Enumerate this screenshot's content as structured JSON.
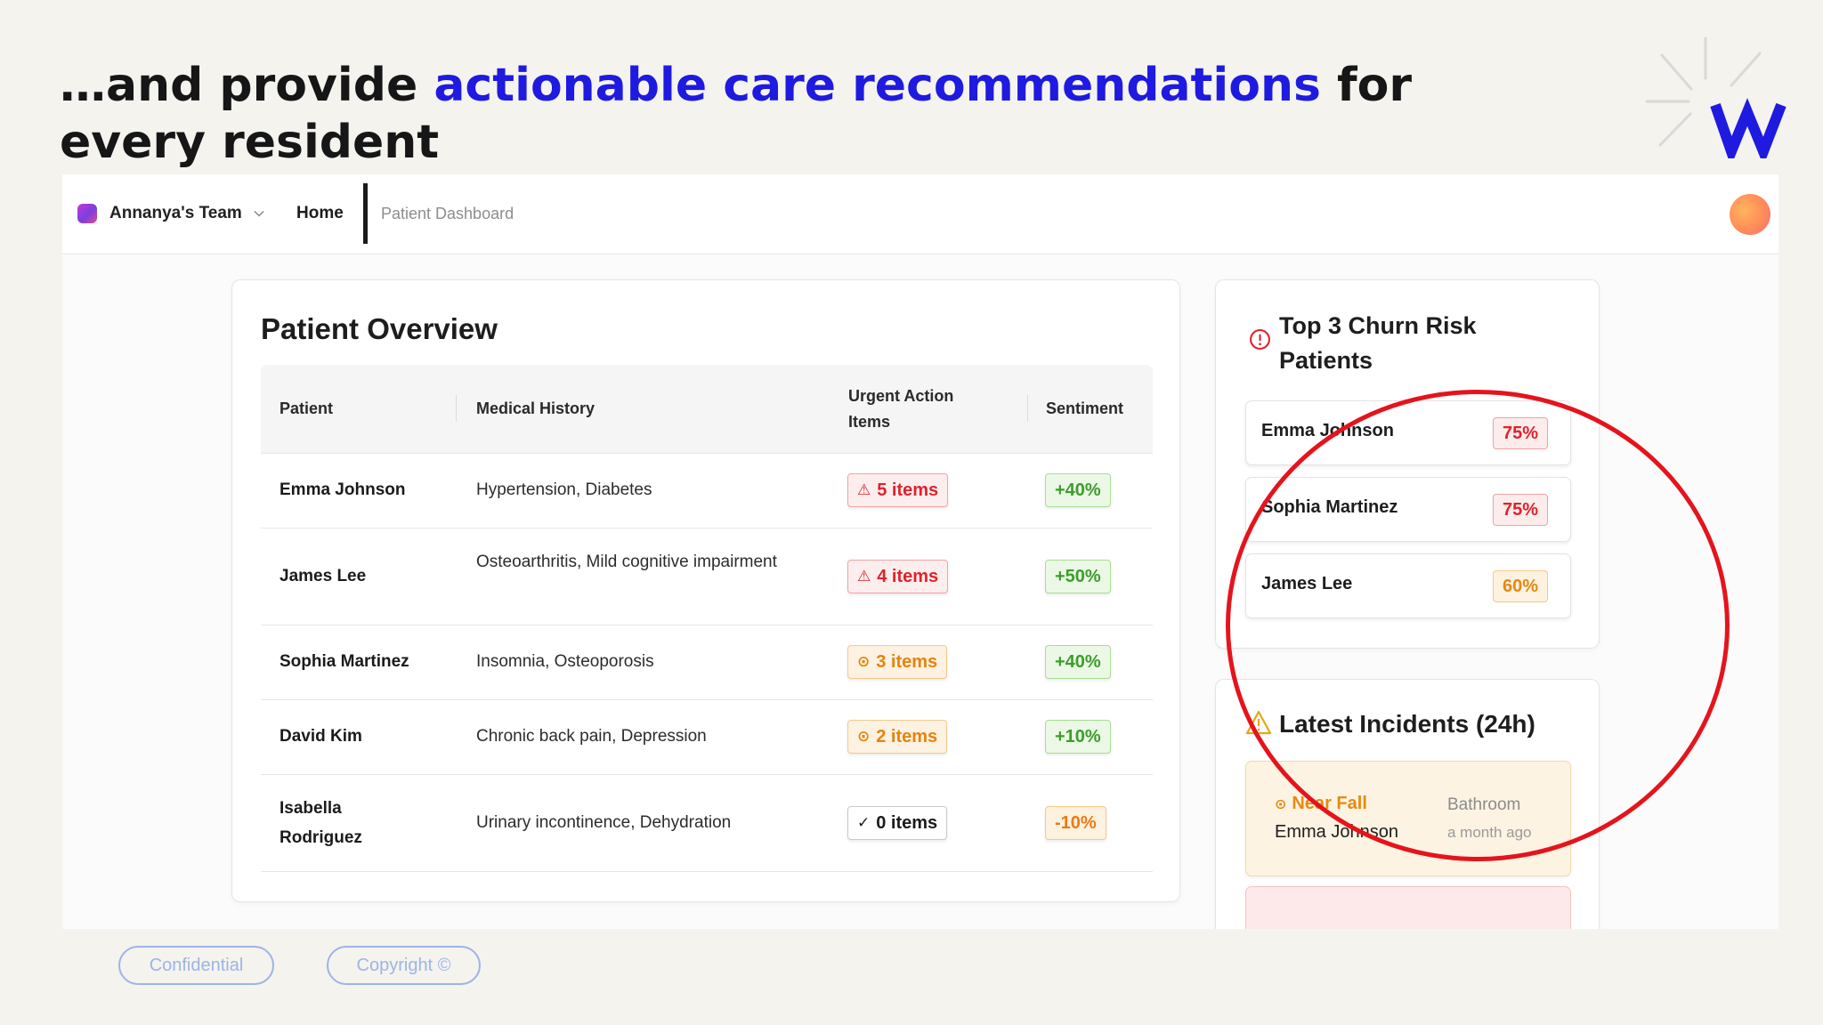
{
  "headline": {
    "before": "…and provide ",
    "accent": "actionable care recommendations",
    "after": " for every resident"
  },
  "brand_colors": {
    "accent": "#1f1ae0",
    "logo": "#1f1ae0",
    "highlight_circle": "#e5141c"
  },
  "topbar": {
    "team_name": "Annanya's Team",
    "nav_home": "Home",
    "breadcrumb": "Patient Dashboard"
  },
  "overview": {
    "title": "Patient Overview",
    "columns": [
      "Patient",
      "Medical History",
      "Urgent Action Items",
      "Sentiment"
    ],
    "rows": [
      {
        "name": "Emma Johnson",
        "history": "Hypertension, Diabetes",
        "items": "5 items",
        "items_level": "red",
        "items_icon": "warning-triangle-icon",
        "sentiment": "+40%",
        "sentiment_level": "green"
      },
      {
        "name": "James Lee",
        "history": "Osteoarthritis, Mild cognitive impairment",
        "items": "4 items",
        "items_level": "red",
        "items_icon": "warning-triangle-icon",
        "sentiment": "+50%",
        "sentiment_level": "green"
      },
      {
        "name": "Sophia Martinez",
        "history": "Insomnia, Osteoporosis",
        "items": "3 items",
        "items_level": "amber",
        "items_icon": "alert-circle-icon",
        "sentiment": "+40%",
        "sentiment_level": "green"
      },
      {
        "name": "David Kim",
        "history": "Chronic back pain, Depression",
        "items": "2 items",
        "items_level": "amber",
        "items_icon": "alert-circle-icon",
        "sentiment": "+10%",
        "sentiment_level": "green"
      },
      {
        "name": "Isabella Rodriguez",
        "history": "Urinary incontinence, Dehydration",
        "items": "0 items",
        "items_level": "neutral",
        "items_icon": "check-icon",
        "sentiment": "-10%",
        "sentiment_level": "orange"
      }
    ]
  },
  "churn": {
    "title": "Top 3 Churn Risk Patients",
    "patients": [
      {
        "name": "Emma Johnson",
        "risk": "75%",
        "level": "red"
      },
      {
        "name": "Sophia Martinez",
        "risk": "75%",
        "level": "red"
      },
      {
        "name": "James Lee",
        "risk": "60%",
        "level": "amber"
      }
    ]
  },
  "incidents": {
    "title": "Latest Incidents (24h)",
    "items": [
      {
        "type": "Near Fall",
        "person": "Emma Johnson",
        "location": "Bathroom",
        "time": "a month ago"
      }
    ]
  },
  "footer": {
    "confidential": "Confidential",
    "copyright": "Copyright ©"
  }
}
